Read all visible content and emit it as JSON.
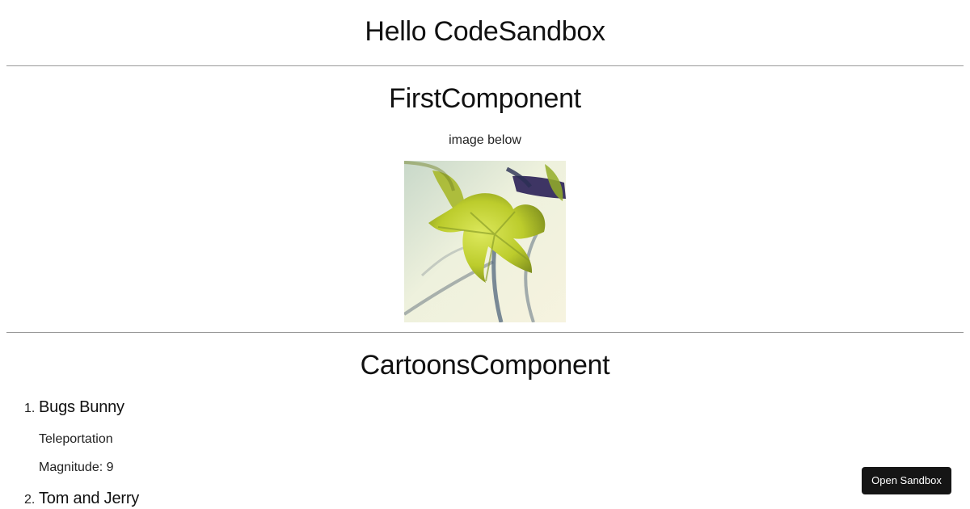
{
  "app": {
    "title": "Hello CodeSandbox"
  },
  "first_component": {
    "heading": "FirstComponent",
    "caption": "image below",
    "image": {
      "subject": "yellow-green leaf on branch",
      "colors": {
        "background": "#dfe7cf",
        "leaf": "#b8c72c",
        "stem": "#3e4f6b",
        "purple": "#2f2559"
      }
    }
  },
  "cartoons_component": {
    "heading": "CartoonsComponent",
    "items": [
      {
        "number": "1.",
        "name": "Bugs Bunny",
        "power": "Teleportation",
        "magnitude": "Magnitude: 9"
      },
      {
        "number": "2.",
        "name": "Tom and Jerry"
      }
    ]
  },
  "actions": {
    "open_sandbox": "Open Sandbox"
  },
  "colors": {
    "text": "#111111",
    "divider": "#999999",
    "button_bg": "#151515",
    "button_text": "#ffffff"
  }
}
